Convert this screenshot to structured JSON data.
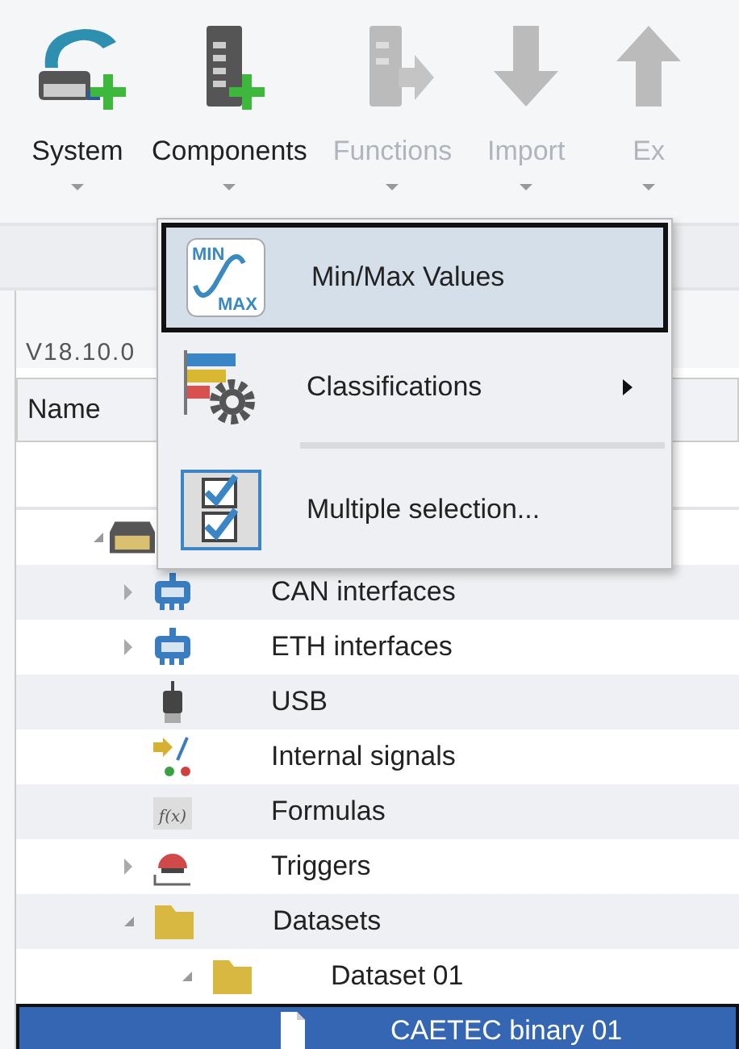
{
  "toolbar": [
    {
      "label": "System",
      "kind": "system",
      "disabled": false
    },
    {
      "label": "Components",
      "kind": "components",
      "disabled": false
    },
    {
      "label": "Functions",
      "kind": "functions",
      "disabled": true
    },
    {
      "label": "Import",
      "kind": "import",
      "disabled": true
    },
    {
      "label": "Ex",
      "kind": "export",
      "disabled": true
    }
  ],
  "version": "V18.10.0",
  "table": {
    "columns": [
      "Name"
    ]
  },
  "tree": [
    {
      "kind": "device",
      "expanded": true,
      "selected": false,
      "children": [
        {
          "label": "CAN interfaces",
          "kind": "can",
          "expanded": false,
          "selected": false
        },
        {
          "label": "ETH interfaces",
          "kind": "eth",
          "expanded": false,
          "selected": false
        },
        {
          "label": "USB",
          "kind": "usb",
          "selected": false
        },
        {
          "label": "Internal signals",
          "kind": "signals",
          "selected": false
        },
        {
          "label": "Formulas",
          "kind": "formula",
          "icon_text": "f(x)",
          "selected": false
        },
        {
          "label": "Triggers",
          "kind": "trigger",
          "expanded": false,
          "selected": false
        },
        {
          "label": "Datasets",
          "kind": "folder",
          "expanded": true,
          "selected": false,
          "children": [
            {
              "label": "Dataset 01",
              "kind": "folder",
              "expanded": true,
              "selected": false,
              "children": [
                {
                  "label": "CAETEC binary 01",
                  "kind": "file",
                  "selected": true
                }
              ]
            }
          ]
        }
      ]
    }
  ],
  "context_menu": [
    {
      "kind": "minmax",
      "icon_text": [
        "MIN",
        "MAX"
      ],
      "label": "Min/Max Values",
      "selected": true,
      "submenu": false
    },
    {
      "kind": "classifications",
      "label": "Classifications",
      "selected": false,
      "submenu": true
    },
    {
      "kind": "separator"
    },
    {
      "kind": "multiselect",
      "label": "Multiple selection...",
      "selected": false,
      "submenu": false
    }
  ]
}
